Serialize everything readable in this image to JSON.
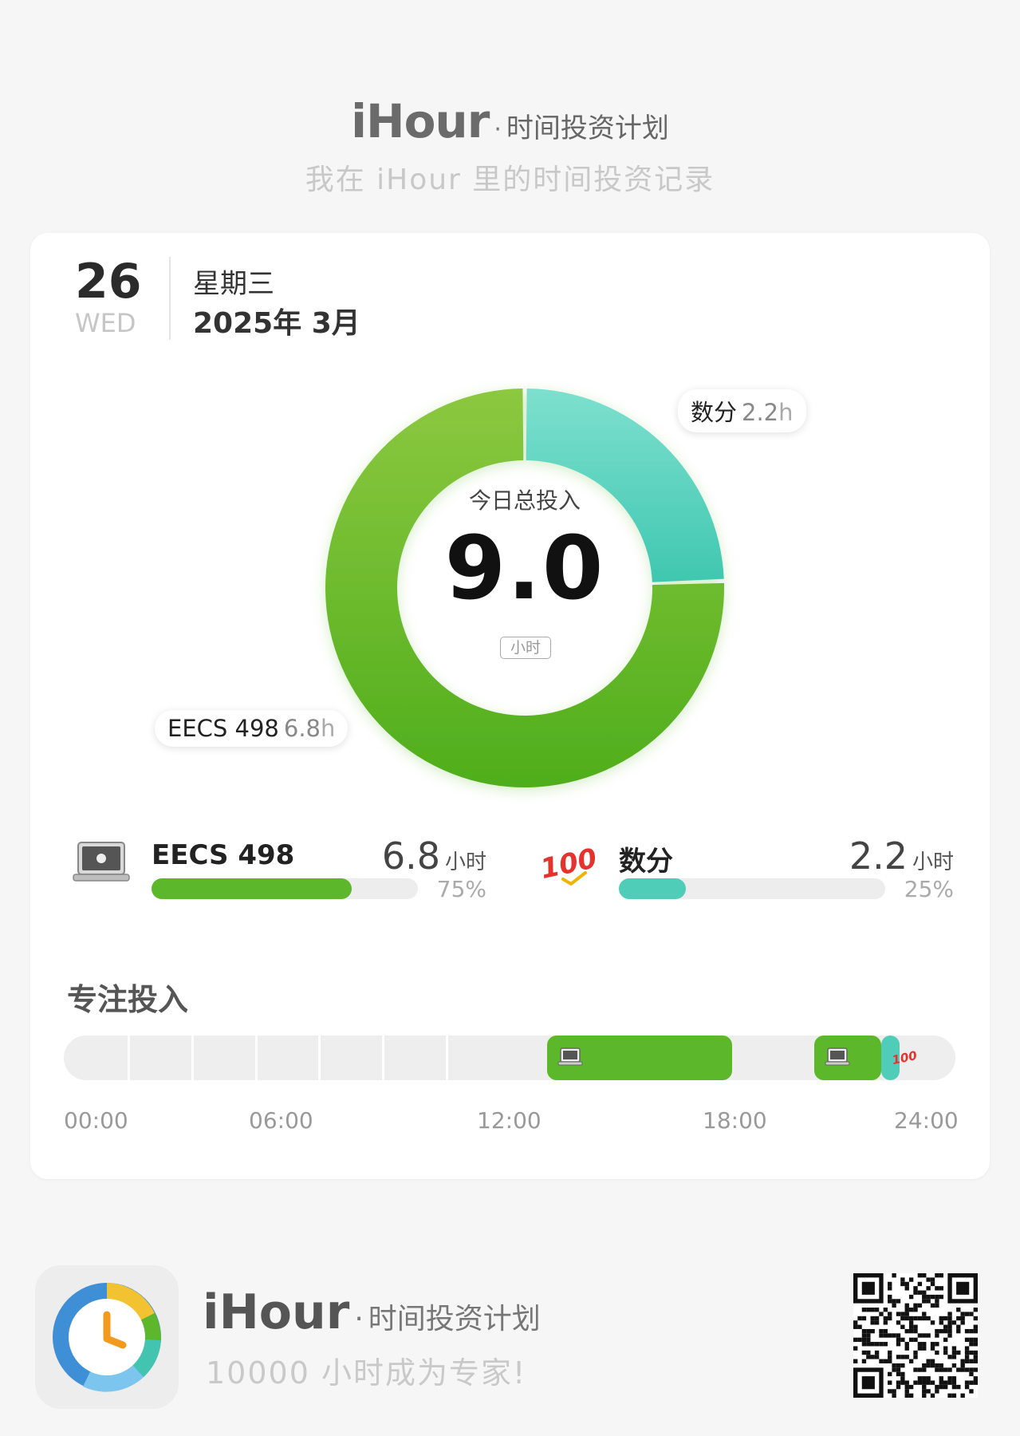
{
  "header": {
    "brand": "iHour",
    "dot": "·",
    "tagline": "时间投资计划",
    "subtitle": "我在 iHour 里的时间投资记录"
  },
  "date": {
    "day": "26",
    "weekday_en": "WED",
    "weekday_cn": "星期三",
    "year_month": "2025年 3月"
  },
  "donut": {
    "center_label": "今日总投入",
    "center_value": "9.0",
    "center_unit": "小时",
    "segments": [
      {
        "name": "数分",
        "hours": 2.2,
        "color_start": "#7ee0cf",
        "color_end": "#3fc7b0"
      },
      {
        "name": "EECS 498",
        "hours": 6.8,
        "color_start": "#8cc840",
        "color_end": "#4fae1c"
      }
    ],
    "callouts": [
      {
        "name": "数分",
        "value": "2.2",
        "unit": "h"
      },
      {
        "name": "EECS 498",
        "value": "6.8",
        "unit": "h"
      }
    ]
  },
  "legend": [
    {
      "name": "EECS 498",
      "hours": "6.8",
      "unit": "小时",
      "percent_label": "75%",
      "fraction": 0.75,
      "color": "#5cb82a",
      "icon": "laptop-icon"
    },
    {
      "name": "数分",
      "hours": "2.2",
      "unit": "小时",
      "percent_label": "25%",
      "fraction": 0.25,
      "color": "#4fcdb8",
      "icon": "hundred-points-icon"
    }
  ],
  "focus": {
    "title": "专注投入",
    "ticks": [
      "00:00",
      "06:00",
      "12:00",
      "18:00",
      "24:00"
    ],
    "range_hours": [
      0,
      24
    ],
    "sessions": [
      {
        "project": "EECS 498",
        "start": 13.0,
        "end": 18.0,
        "icon": "laptop-icon",
        "color": "#5cb82a"
      },
      {
        "project": "EECS 498",
        "start": 20.2,
        "end": 22.0,
        "icon": "laptop-icon",
        "color": "#5cb82a"
      },
      {
        "project": "数分",
        "start": 22.0,
        "end": 24.2,
        "icon": "hundred-points-icon",
        "color": "#4fcdb8"
      }
    ]
  },
  "footer": {
    "brand": "iHour",
    "dot": "·",
    "tagline": "时间投资计划",
    "slogan": "10000 小时成为专家!"
  },
  "colors": {
    "background": "#f6f6f6",
    "card": "#ffffff",
    "eecs": "#5cb82a",
    "shufen": "#4fcdb8"
  }
}
